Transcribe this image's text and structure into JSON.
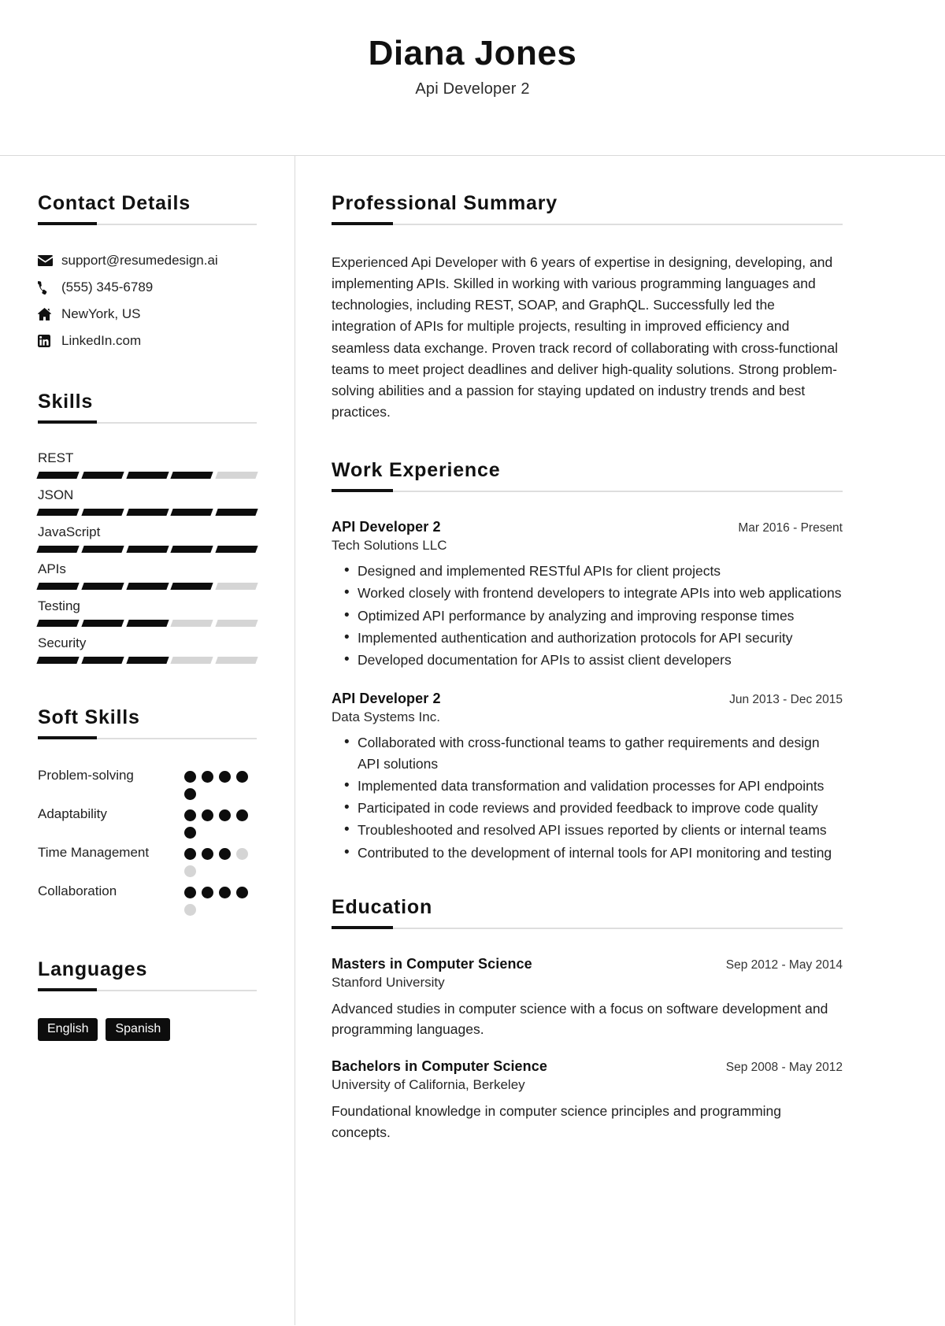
{
  "header": {
    "name": "Diana Jones",
    "title": "Api Developer 2"
  },
  "sidebar": {
    "contact": {
      "heading": "Contact Details",
      "items": [
        {
          "icon": "envelope-icon",
          "text": "support@resumedesign.ai"
        },
        {
          "icon": "phone-icon",
          "text": "(555) 345-6789"
        },
        {
          "icon": "home-icon",
          "text": "NewYork, US"
        },
        {
          "icon": "linkedin-icon",
          "text": "LinkedIn.com"
        }
      ]
    },
    "skills": {
      "heading": "Skills",
      "max": 5,
      "items": [
        {
          "name": "REST",
          "level": 4
        },
        {
          "name": "JSON",
          "level": 5
        },
        {
          "name": "JavaScript",
          "level": 5
        },
        {
          "name": "APIs",
          "level": 4
        },
        {
          "name": "Testing",
          "level": 3
        },
        {
          "name": "Security",
          "level": 3
        }
      ]
    },
    "soft_skills": {
      "heading": "Soft Skills",
      "max": 5,
      "items": [
        {
          "name": "Problem-solving",
          "level": 5
        },
        {
          "name": "Adaptability",
          "level": 5
        },
        {
          "name": "Time Management",
          "level": 3
        },
        {
          "name": "Collaboration",
          "level": 4
        }
      ]
    },
    "languages": {
      "heading": "Languages",
      "items": [
        "English",
        "Spanish"
      ]
    }
  },
  "main": {
    "summary": {
      "heading": "Professional Summary",
      "text": "Experienced Api Developer with 6 years of expertise in designing, developing, and implementing APIs. Skilled in working with various programming languages and technologies, including REST, SOAP, and GraphQL. Successfully led the integration of APIs for multiple projects, resulting in improved efficiency and seamless data exchange. Proven track record of collaborating with cross-functional teams to meet project deadlines and deliver high-quality solutions. Strong problem-solving abilities and a passion for staying updated on industry trends and best practices."
    },
    "experience": {
      "heading": "Work Experience",
      "entries": [
        {
          "role": "API Developer 2",
          "company": "Tech Solutions LLC",
          "date": "Mar 2016 - Present",
          "bullets": [
            "Designed and implemented RESTful APIs for client projects",
            "Worked closely with frontend developers to integrate APIs into web applications",
            "Optimized API performance by analyzing and improving response times",
            "Implemented authentication and authorization protocols for API security",
            "Developed documentation for APIs to assist client developers"
          ]
        },
        {
          "role": "API Developer 2",
          "company": "Data Systems Inc.",
          "date": "Jun 2013 - Dec 2015",
          "bullets": [
            "Collaborated with cross-functional teams to gather requirements and design API solutions",
            "Implemented data transformation and validation processes for API endpoints",
            "Participated in code reviews and provided feedback to improve code quality",
            "Troubleshooted and resolved API issues reported by clients or internal teams",
            "Contributed to the development of internal tools for API monitoring and testing"
          ]
        }
      ]
    },
    "education": {
      "heading": "Education",
      "entries": [
        {
          "degree": "Masters in Computer Science",
          "school": "Stanford University",
          "date": "Sep 2012 - May 2014",
          "description": "Advanced studies in computer science with a focus on software development and programming languages."
        },
        {
          "degree": "Bachelors in Computer Science",
          "school": "University of California, Berkeley",
          "date": "Sep 2008 - May 2012",
          "description": "Foundational knowledge in computer science principles and programming concepts."
        }
      ]
    }
  },
  "colors": {
    "accent": "#0d0d0d",
    "muted": "#d5d5d5",
    "rule": "#dedede"
  }
}
